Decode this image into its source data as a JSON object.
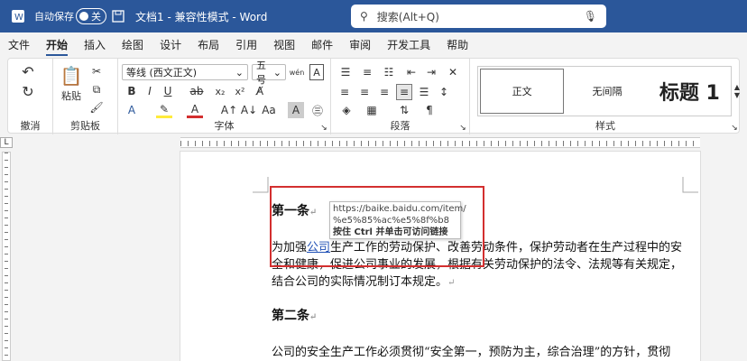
{
  "titlebar": {
    "autosave_label": "自动保存",
    "autosave_state": "关",
    "doc_title": "文档1  -  兼容性模式  -  Word",
    "search_placeholder": "搜索(Alt+Q)"
  },
  "menu": {
    "tabs": [
      "文件",
      "开始",
      "插入",
      "绘图",
      "设计",
      "布局",
      "引用",
      "视图",
      "邮件",
      "审阅",
      "开发工具",
      "帮助"
    ],
    "active_index": 1
  },
  "ribbon": {
    "groups": {
      "undo": "撤消",
      "clipboard": "剪贴板",
      "font": "字体",
      "paragraph": "段落",
      "styles": "样式"
    },
    "paste_label": "粘贴",
    "font_name": "等线 (西文正文)",
    "font_size": "五号",
    "styles": [
      "正文",
      "无间隔",
      "标题 1"
    ]
  },
  "document": {
    "article1_title": "第一条",
    "para1_before_link": "为加强",
    "para1_link": "公司",
    "para1_after_link": "生产工作的劳动保护、改善劳动条件，保护劳动者在生产过程中的安",
    "para1_line2": "全和健康，促进公司事业的发展，根据有关劳动保护的法令、法规等有关规定，",
    "para1_line3": "结合公司的实际情况制订本规定。",
    "article2_title": "第二条",
    "para2_line1": "公司的安全生产工作必须贯彻“安全第一，预防为主，综合治理”的方针，贯彻"
  },
  "tooltip": {
    "url_line1": "https://baike.baidu.com/item/",
    "url_line2": "%e5%85%ac%e5%8f%b8",
    "hint": "按住 Ctrl 并单击可访问链接"
  },
  "colors": {
    "titlebar": "#2b579a",
    "highlight_box": "#d32f2f",
    "link": "#1f4fb5"
  }
}
